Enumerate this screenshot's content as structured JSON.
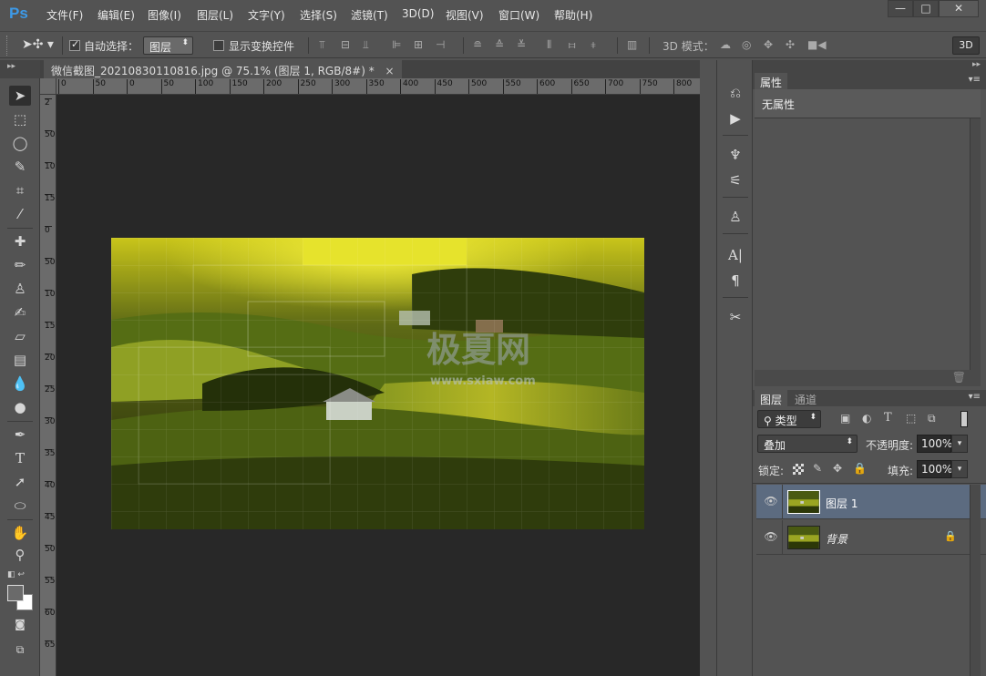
{
  "app": {
    "logo": "Ps"
  },
  "menu": [
    "文件(F)",
    "编辑(E)",
    "图像(I)",
    "图层(L)",
    "文字(Y)",
    "选择(S)",
    "滤镜(T)",
    "3D(D)",
    "视图(V)",
    "窗口(W)",
    "帮助(H)"
  ],
  "window_controls": {
    "minimize": "—",
    "maximize": "□",
    "close": "✕"
  },
  "options": {
    "auto_select_label": "自动选择：",
    "auto_select_checked": true,
    "auto_select_target": "图层",
    "transform_controls_label": "显示变换控件",
    "mode_3d_label": "3D 模式：",
    "workspace_3d": "3D"
  },
  "document": {
    "tab_title": "微信截图_20210830110816.jpg @ 75.1% (图层 1, RGB/8#) *",
    "close": "×",
    "ruler_h": [
      "0",
      "50",
      "0",
      "50",
      "100",
      "150",
      "200",
      "250",
      "300",
      "350",
      "400",
      "450",
      "500",
      "550",
      "600",
      "650",
      "700",
      "750",
      "800",
      "8"
    ],
    "ruler_v": [
      "2",
      "50",
      "100",
      "150",
      "0",
      "50",
      "100",
      "150",
      "200",
      "250",
      "300",
      "350",
      "400",
      "450",
      "500",
      "550",
      "600",
      "650"
    ],
    "watermark_main": "极夏网",
    "watermark_sub": "www.sxiaw.com"
  },
  "properties": {
    "tab": "属性",
    "empty_text": "无属性"
  },
  "layers_panel": {
    "tabs": [
      "图层",
      "通道"
    ],
    "filter_kind": "类型",
    "blend_mode": "叠加",
    "opacity_label": "不透明度:",
    "opacity_value": "100%",
    "lock_label": "锁定:",
    "fill_label": "填充:",
    "fill_value": "100%",
    "layers": [
      {
        "name": "图层 1",
        "selected": true,
        "visible": true,
        "locked": false
      },
      {
        "name": "背景",
        "selected": false,
        "visible": true,
        "locked": true
      }
    ]
  },
  "colors": {
    "accent": "#3d9ae8",
    "selected_layer": "#5c6b80",
    "canvas_bg": "#282828"
  }
}
